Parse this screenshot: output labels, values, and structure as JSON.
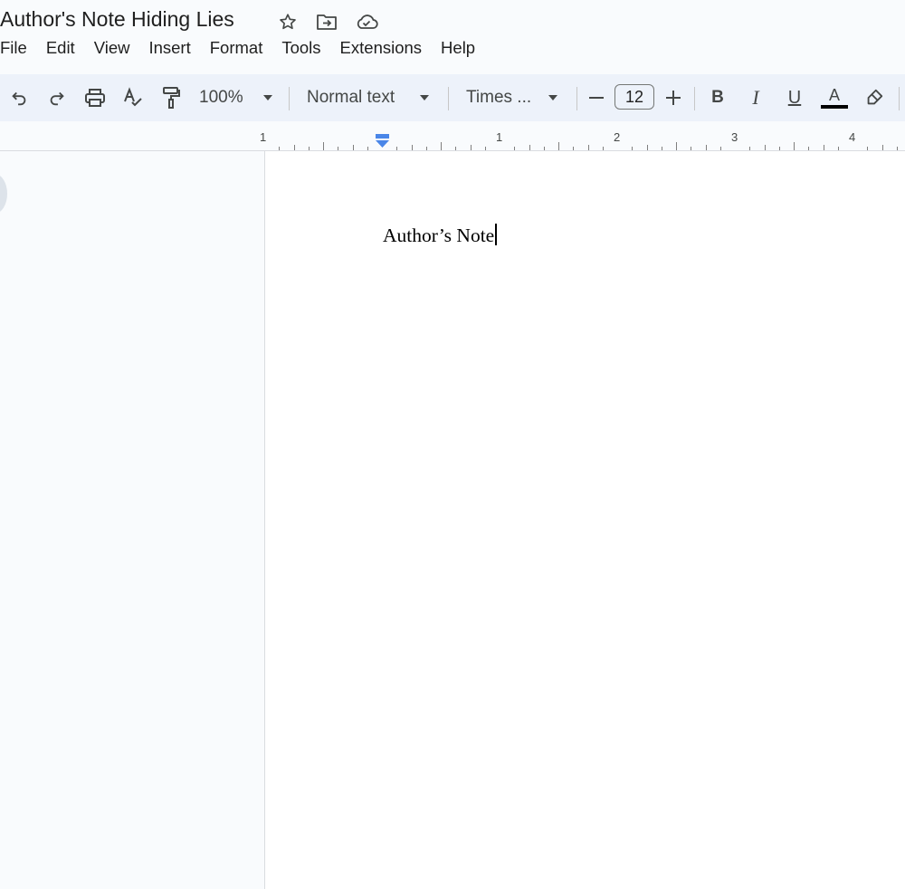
{
  "title": "Author's Note Hiding Lies",
  "title_icons": [
    "star-icon",
    "move-folder-icon",
    "cloud-saved-icon"
  ],
  "menu": [
    "File",
    "Edit",
    "View",
    "Insert",
    "Format",
    "Tools",
    "Extensions",
    "Help"
  ],
  "toolbar": {
    "zoom": "100%",
    "style": "Normal text",
    "font": "Times ...",
    "font_size": "12",
    "bold_label": "B",
    "italic_label": "I",
    "underline_label": "U",
    "text_color_label": "A",
    "text_color": "#000000"
  },
  "ruler": {
    "labels": [
      "1",
      "1",
      "2",
      "3",
      "4"
    ],
    "accent": "#4a86e8"
  },
  "document": {
    "text": "Author’s Note"
  }
}
